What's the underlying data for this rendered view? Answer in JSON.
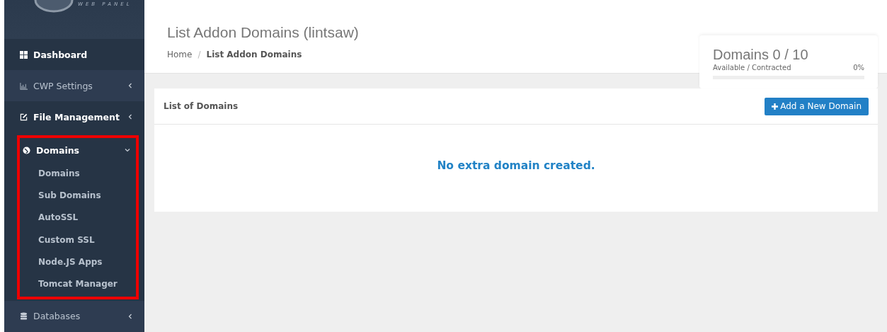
{
  "sidebar": {
    "logo_text": "WEB PANEL",
    "items": [
      {
        "label": "Dashboard",
        "hovered": false,
        "has_caret": false,
        "expanded": false,
        "highlighted": false
      },
      {
        "label": "CWP Settings",
        "hovered": true,
        "has_caret": true,
        "expanded": false,
        "highlighted": false
      },
      {
        "label": "File Management",
        "hovered": false,
        "has_caret": true,
        "expanded": false,
        "highlighted": false
      },
      {
        "label": "Domains",
        "hovered": false,
        "has_caret": true,
        "expanded": true,
        "highlighted": true,
        "children": [
          {
            "label": "Domains"
          },
          {
            "label": "Sub Domains"
          },
          {
            "label": "AutoSSL"
          },
          {
            "label": "Custom SSL"
          },
          {
            "label": "Node.JS Apps"
          },
          {
            "label": "Tomcat Manager"
          }
        ]
      },
      {
        "label": "Databases",
        "hovered": true,
        "has_caret": true,
        "expanded": false,
        "highlighted": false
      }
    ]
  },
  "header": {
    "title": "List Addon Domains (lintsaw)",
    "separator": "/",
    "breadcrumb": [
      {
        "label": "Home"
      },
      {
        "label": "List Addon Domains"
      }
    ]
  },
  "stats": {
    "title": "Domains 0 / 10",
    "caption": "Available / Contracted",
    "percent": "0%",
    "level": 0
  },
  "panel": {
    "title": "List of Domains",
    "button": "Add a New Domain",
    "message": "No extra domain created."
  }
}
